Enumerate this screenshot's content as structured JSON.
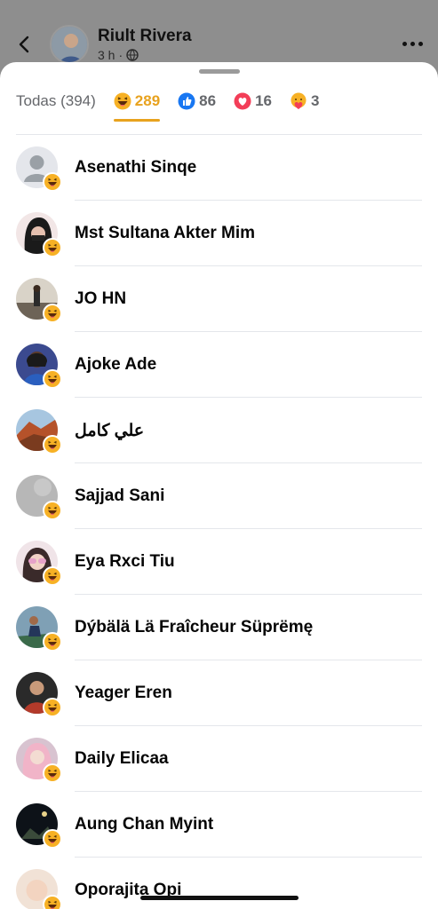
{
  "header": {
    "author_name": "Riult Rivera",
    "time": "3 h",
    "back_icon": "chevron-left-icon",
    "more_icon": "more-horizontal-icon",
    "privacy_icon": "globe-icon"
  },
  "tabs": [
    {
      "label": "Todas (394)",
      "icon": null
    },
    {
      "label": "289",
      "icon": "haha-reaction-icon",
      "active": true
    },
    {
      "label": "86",
      "icon": "like-reaction-icon"
    },
    {
      "label": "16",
      "icon": "love-reaction-icon"
    },
    {
      "label": "3",
      "icon": "care-reaction-icon"
    }
  ],
  "colors": {
    "active_tab": "#e8a21e",
    "like": "#1877f2",
    "love": "#f33e58",
    "haha": "#f7b125"
  },
  "people": [
    {
      "name": "Asenathi Sinqe",
      "avatar": "default-avatar"
    },
    {
      "name": "Mst Sultana Akter Mim",
      "avatar": "photo"
    },
    {
      "name": "JO HN",
      "avatar": "photo"
    },
    {
      "name": "Ajoke Ade",
      "avatar": "photo"
    },
    {
      "name": "علي كامل",
      "avatar": "photo"
    },
    {
      "name": "Sajjad Sani",
      "avatar": "photo"
    },
    {
      "name": "Eya Rxci Tiu",
      "avatar": "photo"
    },
    {
      "name": "Dýbälä Lä Fraîcheur Süprëmę",
      "avatar": "photo"
    },
    {
      "name": "Yeager Eren",
      "avatar": "photo"
    },
    {
      "name": "Daily Elicaa",
      "avatar": "photo"
    },
    {
      "name": "Aung Chan Myint",
      "avatar": "photo"
    },
    {
      "name": "Oporajita Opi",
      "avatar": "photo"
    }
  ]
}
